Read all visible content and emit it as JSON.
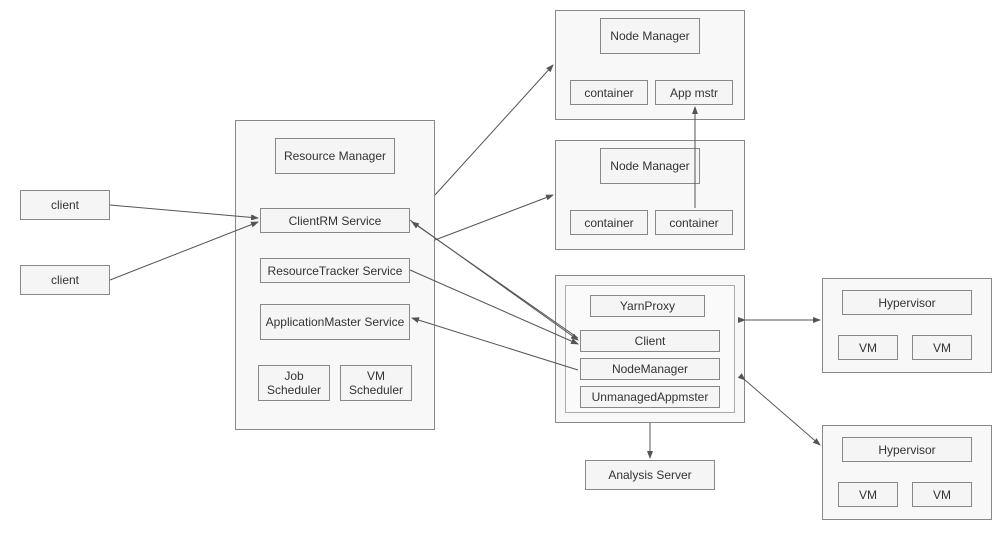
{
  "clients": {
    "client1": "client",
    "client2": "client"
  },
  "resourceManager": {
    "title": "Resource Manager",
    "clientRM": "ClientRM Service",
    "resourceTracker": "ResourceTracker Service",
    "appMaster": "ApplicationMaster Service",
    "jobScheduler": "Job Scheduler",
    "vmScheduler": "VM Scheduler"
  },
  "node1": {
    "title": "Node Manager",
    "container": "container",
    "appmstr": "App mstr"
  },
  "node2": {
    "title": "Node Manager",
    "container1": "container",
    "container2": "container"
  },
  "proxyNode": {
    "yarnProxy": "YarnProxy",
    "client": "Client",
    "nodeManager": "NodeManager",
    "unmanaged": "UnmanagedAppmster"
  },
  "analysis": "Analysis Server",
  "hypervisor1": {
    "title": "Hypervisor",
    "vm1": "VM",
    "vm2": "VM"
  },
  "hypervisor2": {
    "title": "Hypervisor",
    "vm1": "VM",
    "vm2": "VM"
  }
}
